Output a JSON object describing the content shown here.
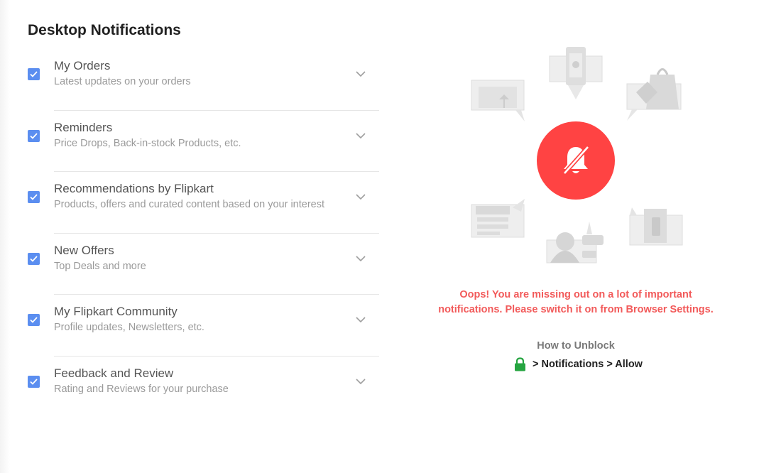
{
  "page": {
    "title": "Desktop Notifications"
  },
  "preferences": [
    {
      "label": "My Orders",
      "description": "Latest updates on your orders",
      "checked": true
    },
    {
      "label": "Reminders",
      "description": "Price Drops, Back-in-stock Products, etc.",
      "checked": true
    },
    {
      "label": "Recommendations by Flipkart",
      "description": "Products, offers and curated content based on your interest",
      "checked": true
    },
    {
      "label": "New Offers",
      "description": "Top Deals and more",
      "checked": true
    },
    {
      "label": "My Flipkart Community",
      "description": "Profile updates, Newsletters, etc.",
      "checked": true
    },
    {
      "label": "Feedback and Review",
      "description": "Rating and Reviews for your purchase",
      "checked": true
    }
  ],
  "blocked": {
    "icon": "bell-off-icon",
    "warning_line1": "Oops! You are missing out on a lot of important",
    "warning_line2": "notifications. Please switch it on from Browser Settings.",
    "how_to_title": "How to Unblock",
    "steps": "> Notifications > Allow",
    "lock_icon": "lock-icon"
  },
  "colors": {
    "checkbox": "#5b8ef0",
    "alert_red": "#ff4343",
    "warning_text": "#f25a5a",
    "lock_green": "#26a541"
  }
}
